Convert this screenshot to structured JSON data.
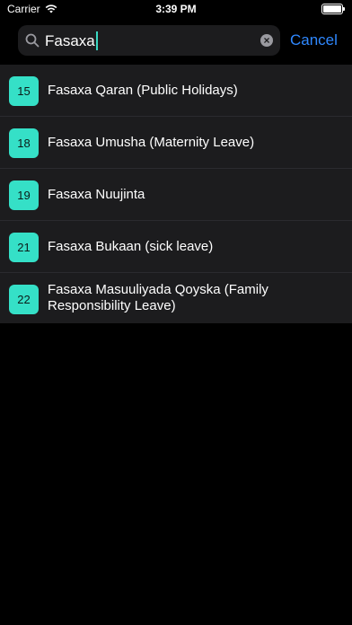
{
  "status_bar": {
    "carrier": "Carrier",
    "time": "3:39 PM"
  },
  "search": {
    "value": "Fasaxa",
    "cancel_label": "Cancel"
  },
  "results": [
    {
      "number": "15",
      "title": "Fasaxa Qaran (Public Holidays)"
    },
    {
      "number": "18",
      "title": "Fasaxa Umusha (Maternity Leave)"
    },
    {
      "number": "19",
      "title": "Fasaxa Nuujinta"
    },
    {
      "number": "21",
      "title": "Fasaxa Bukaan (sick leave)"
    },
    {
      "number": "22",
      "title": "Fasaxa Masuuliyada Qoyska (Family Responsibility Leave)"
    }
  ],
  "colors": {
    "accent": "#35e0c7",
    "link": "#2f88ff",
    "background": "#000000",
    "row_bg": "#1c1c1e"
  },
  "icons": {
    "search": "search-icon",
    "clear": "clear-icon",
    "wifi": "wifi-icon",
    "battery": "battery-icon"
  }
}
